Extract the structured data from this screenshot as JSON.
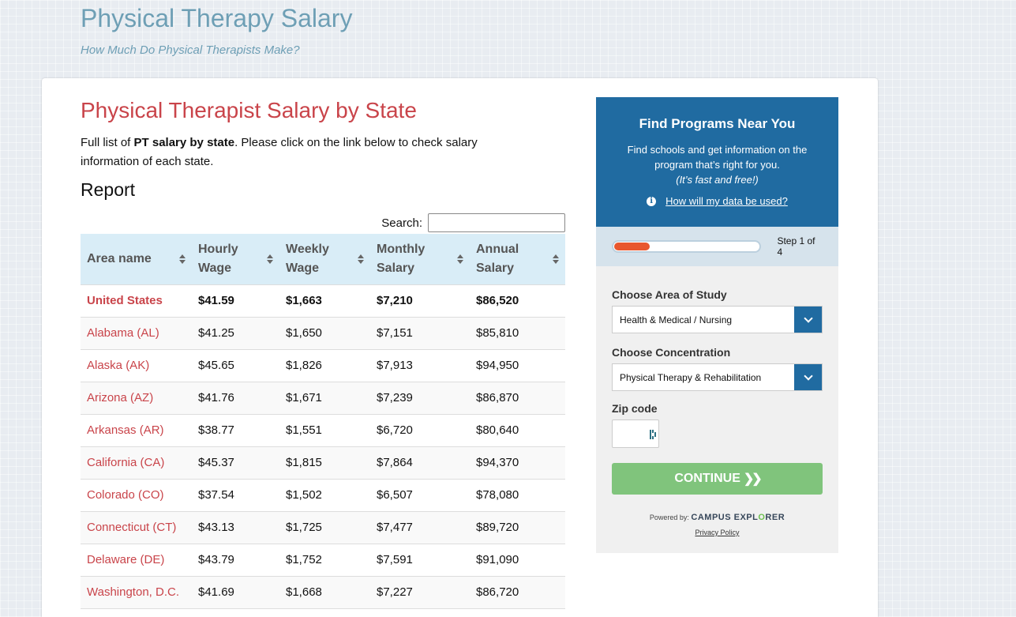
{
  "header": {
    "title": "Physical Therapy Salary",
    "subtitle": "How Much Do Physical Therapists Make?"
  },
  "main": {
    "title": "Physical Therapist Salary by State",
    "intro_before": "Full list of ",
    "intro_bold": "PT salary by state",
    "intro_after": ". Please click on the link below to check salary information of each state.",
    "report_heading": "Report",
    "search_label": "Search:",
    "search_value": "",
    "table": {
      "columns": [
        {
          "label": "Area name"
        },
        {
          "label": "Hourly Wage"
        },
        {
          "label": "Weekly Wage"
        },
        {
          "label": "Monthly Salary"
        },
        {
          "label": "Annual Salary"
        }
      ],
      "rows": [
        {
          "area": "United States",
          "hourly": "$41.59",
          "weekly": "$1,663",
          "monthly": "$7,210",
          "annual": "$86,520"
        },
        {
          "area": "Alabama (AL)",
          "hourly": "$41.25",
          "weekly": "$1,650",
          "monthly": "$7,151",
          "annual": "$85,810"
        },
        {
          "area": "Alaska (AK)",
          "hourly": "$45.65",
          "weekly": "$1,826",
          "monthly": "$7,913",
          "annual": "$94,950"
        },
        {
          "area": "Arizona (AZ)",
          "hourly": "$41.76",
          "weekly": "$1,671",
          "monthly": "$7,239",
          "annual": "$86,870"
        },
        {
          "area": "Arkansas (AR)",
          "hourly": "$38.77",
          "weekly": "$1,551",
          "monthly": "$6,720",
          "annual": "$80,640"
        },
        {
          "area": "California (CA)",
          "hourly": "$45.37",
          "weekly": "$1,815",
          "monthly": "$7,864",
          "annual": "$94,370"
        },
        {
          "area": "Colorado (CO)",
          "hourly": "$37.54",
          "weekly": "$1,502",
          "monthly": "$6,507",
          "annual": "$78,080"
        },
        {
          "area": "Connecticut (CT)",
          "hourly": "$43.13",
          "weekly": "$1,725",
          "monthly": "$7,477",
          "annual": "$89,720"
        },
        {
          "area": "Delaware (DE)",
          "hourly": "$43.79",
          "weekly": "$1,752",
          "monthly": "$7,591",
          "annual": "$91,090"
        },
        {
          "area": "Washington, D.C.",
          "hourly": "$41.69",
          "weekly": "$1,668",
          "monthly": "$7,227",
          "annual": "$86,720"
        }
      ]
    }
  },
  "widget": {
    "title": "Find Programs Near You",
    "desc": "Find schools and get information on the program that’s right for you.",
    "desc_italic": "(It’s fast and free!)",
    "data_link": "How will my data be used?",
    "progress_fraction": 0.25,
    "step_label": "Step 1 of 4",
    "area_label": "Choose Area of Study",
    "area_value": "Health & Medical / Nursing",
    "concentration_label": "Choose Concentration",
    "concentration_value": "Physical Therapy & Rehabilitation",
    "zip_label": "Zip code",
    "zip_value": "",
    "continue_label": "CONTINUE",
    "powered_by": "Powered by:",
    "brand_part1": "CAMPUS EXPL",
    "brand_o": "O",
    "brand_part2": "RER",
    "privacy": "Privacy Policy"
  },
  "colors": {
    "accent_red": "#c9444a",
    "header_blue": "#6e9fb5",
    "widget_blue": "#206ba1",
    "progress_orange": "#e8572e",
    "continue_green": "#80c47c",
    "table_header_bg": "#d9edf7"
  }
}
